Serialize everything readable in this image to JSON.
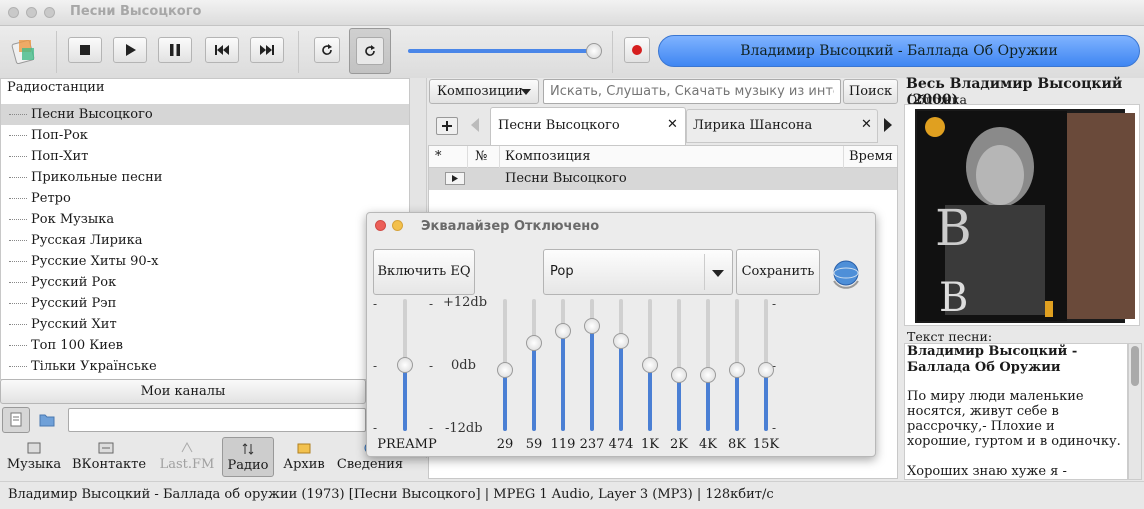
{
  "window": {
    "title": "Песни Высоцкого"
  },
  "now_playing": "Владимир Высоцкий - Баллада Об Оружии",
  "radio": {
    "header": "Радиостанции",
    "items": [
      "Песни Высоцкого",
      "Поп-Рок",
      "Поп-Хит",
      "Прикольные песни",
      "Ретро",
      "Рок Музыка",
      "Русская Лирика",
      "Русские Хиты 90-х",
      "Русский Рок",
      "Русский Рэп",
      "Русский Хит",
      "Топ 100 Киев",
      "Тільки Українське"
    ],
    "my_channels": "Мои каналы"
  },
  "bottom_tabs": [
    "Музыка",
    "ВКонтакте",
    "Last.FM",
    "Радио",
    "Архив",
    "Сведения"
  ],
  "search": {
    "mode": "Композиции",
    "placeholder": "Искать, Слушать, Скачать музыку из инте...",
    "button": "Поиск"
  },
  "playlist_tabs": [
    "Песни Высоцкого",
    "Лирика Шансона"
  ],
  "playlist": {
    "columns": [
      "*",
      "№",
      "Композиция",
      "Время"
    ],
    "rows": [
      {
        "title": "Песни Высоцкого"
      }
    ]
  },
  "album": {
    "title": "Весь Владимир Высоцкий (2000)",
    "cover_label": "Обложка",
    "lyrics_label": "Текст песни:",
    "lyrics_heading": "Владимир Высоцкий - Баллада Об Оружии",
    "lyrics_para1": "По миру люди маленькие носятся, живут себе в рассрочку,- Плохие и хорошие, гуртом и в одиночку.",
    "lyrics_para2": "Хороших знаю хуже я -"
  },
  "equalizer": {
    "title": "Эквалайзер Отключено",
    "enable_button": "Включить EQ",
    "preset": "Pop",
    "save_button": "Сохранить",
    "scale": [
      "+12db",
      "0db",
      "-12db"
    ],
    "preamp_label": "PREAMP",
    "preamp_level": 0,
    "bands": [
      {
        "label": "29",
        "level": -1
      },
      {
        "label": "59",
        "level": 4.5
      },
      {
        "label": "119",
        "level": 7
      },
      {
        "label": "237",
        "level": 8
      },
      {
        "label": "474",
        "level": 5
      },
      {
        "label": "1K",
        "level": 0
      },
      {
        "label": "2K",
        "level": -2
      },
      {
        "label": "4K",
        "level": -2
      },
      {
        "label": "8K",
        "level": -1
      },
      {
        "label": "15K",
        "level": -1
      }
    ]
  },
  "status_bar": "Владимир Высоцкий - Баллада об оружии (1973) [Песни Высоцкого] | MPEG 1 Audio, Layer 3 (MP3) | 128кбит/с",
  "colors": {
    "accent": "#4a86e8",
    "eq_fill": "#4a7fd4"
  }
}
